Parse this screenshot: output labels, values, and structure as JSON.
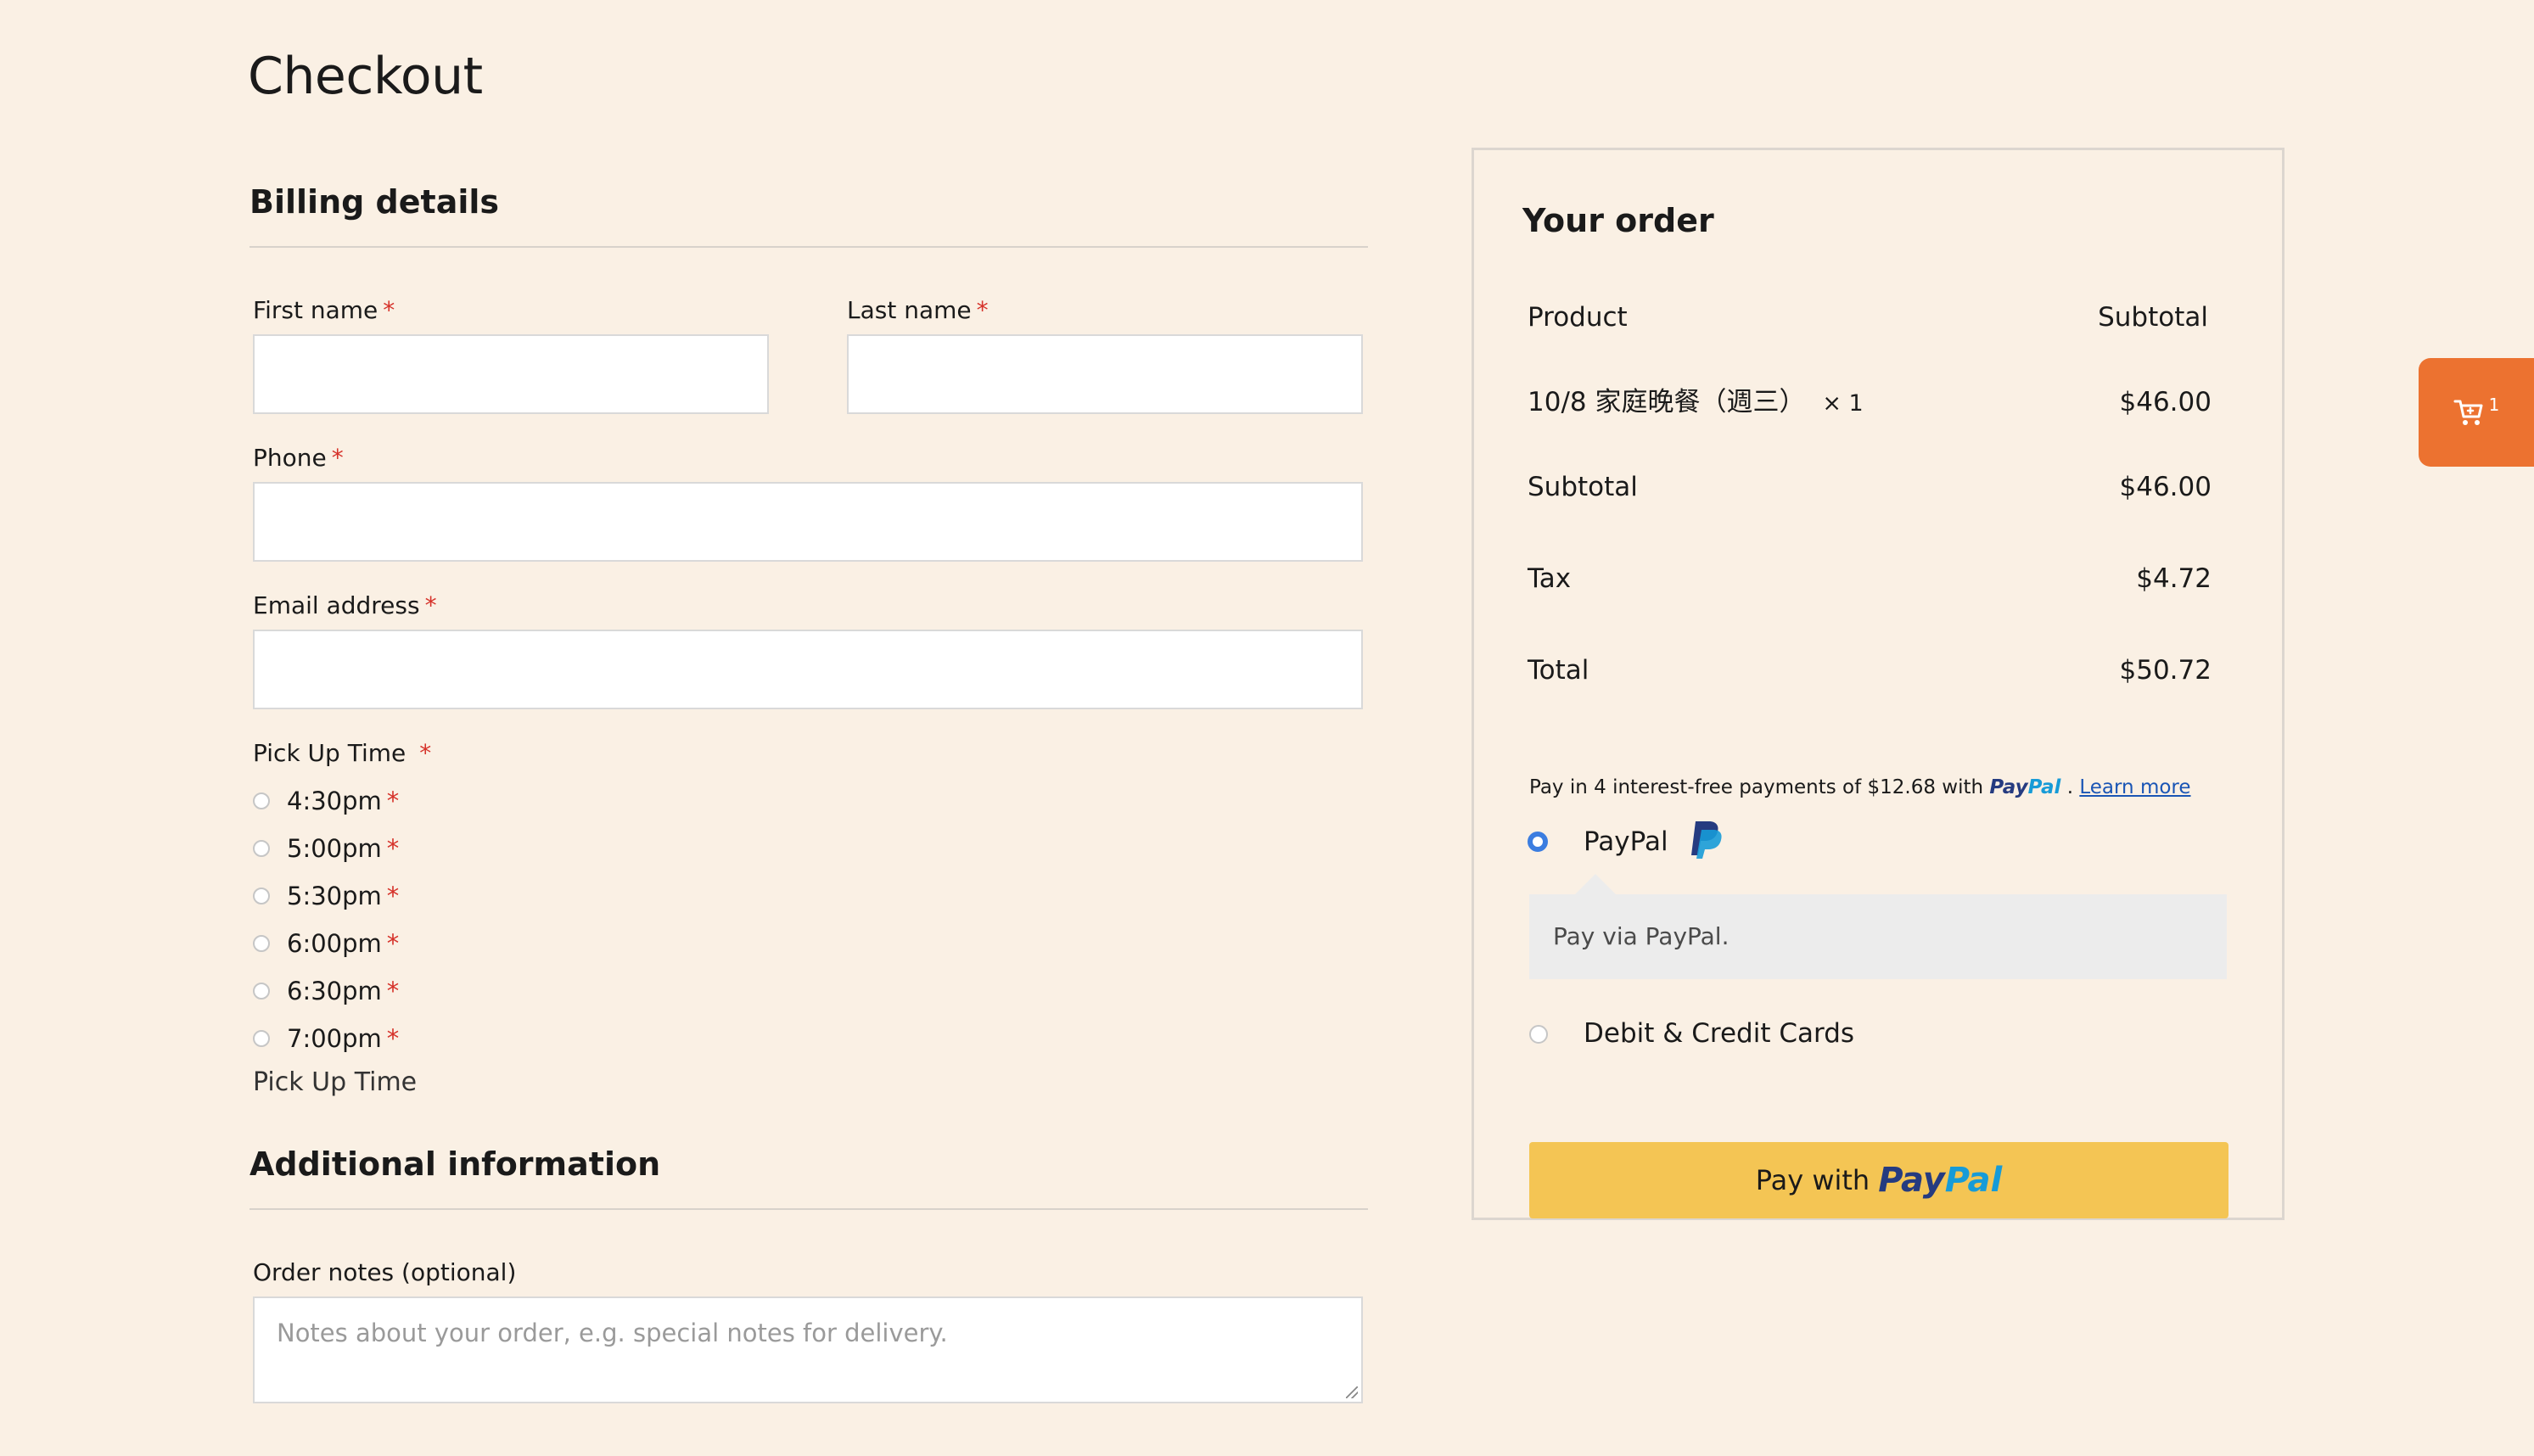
{
  "page": {
    "title": "Checkout"
  },
  "billing": {
    "title": "Billing details",
    "first_name_label": "First name",
    "last_name_label": "Last name",
    "phone_label": "Phone",
    "email_label": "Email address",
    "required_mark": "*",
    "pickup": {
      "label": "Pick Up Time",
      "options": [
        "4:30pm",
        "5:00pm",
        "5:30pm",
        "6:00pm",
        "6:30pm",
        "7:00pm"
      ],
      "footer_label": "Pick Up Time"
    }
  },
  "additional": {
    "title": "Additional information",
    "notes_label": "Order notes (optional)",
    "notes_placeholder": "Notes about your order, e.g. special notes for delivery."
  },
  "order": {
    "title": "Your order",
    "col_product": "Product",
    "col_subtotal": "Subtotal",
    "item_name": "10/8 家庭晚餐（週三）",
    "item_qty": "× 1",
    "item_price": "$46.00",
    "subtotal_label": "Subtotal",
    "subtotal_value": "$46.00",
    "tax_label": "Tax",
    "tax_value": "$4.72",
    "total_label": "Total",
    "total_value": "$50.72"
  },
  "payment": {
    "paylater_prefix": "Pay in 4 interest-free payments of $12.68 with",
    "paylater_brand_a": "Pay",
    "paylater_brand_b": "Pal",
    "paylater_dot": ".",
    "learn_more": "Learn more",
    "paypal_label": "PayPal",
    "paypal_note": "Pay via PayPal.",
    "cards_label": "Debit & Credit Cards",
    "button_prefix": "Pay with",
    "button_brand_a": "Pay",
    "button_brand_b": "Pal"
  },
  "cart": {
    "count": "1"
  },
  "colors": {
    "accent": "#ec7230",
    "paypal_button": "#f4c554",
    "required": "#d6322a",
    "background": "#faf0e4"
  },
  "icons": {
    "cart": "cart-icon",
    "paypal_logo": "paypal-logo-icon"
  }
}
